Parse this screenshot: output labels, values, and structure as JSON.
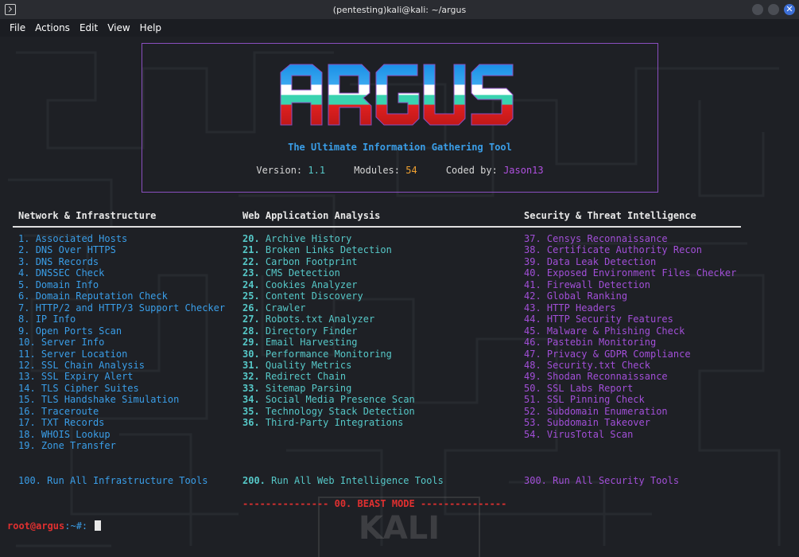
{
  "window": {
    "title": "(pentesting)kali@kali: ~/argus"
  },
  "menu": [
    "File",
    "Actions",
    "Edit",
    "View",
    "Help"
  ],
  "banner": {
    "logo_text": "ARGUS",
    "tagline": "The Ultimate Information Gathering Tool",
    "version_label": "Version: ",
    "version": "1.1",
    "modules_label": "Modules: ",
    "modules": "54",
    "coded_label": "Coded by: ",
    "author": "Jason13"
  },
  "watermark": "KALI",
  "columns": [
    {
      "header": "Network & Infrastructure",
      "items": [
        {
          "n": "1.",
          "t": "Associated Hosts"
        },
        {
          "n": "2.",
          "t": "DNS Over HTTPS"
        },
        {
          "n": "3.",
          "t": "DNS Records"
        },
        {
          "n": "4.",
          "t": "DNSSEC Check"
        },
        {
          "n": "5.",
          "t": "Domain Info"
        },
        {
          "n": "6.",
          "t": "Domain Reputation Check"
        },
        {
          "n": "7.",
          "t": "HTTP/2 and HTTP/3 Support Checker"
        },
        {
          "n": "8.",
          "t": "IP Info"
        },
        {
          "n": "9.",
          "t": "Open Ports Scan"
        },
        {
          "n": "10.",
          "t": "Server Info"
        },
        {
          "n": "11.",
          "t": "Server Location"
        },
        {
          "n": "12.",
          "t": "SSL Chain Analysis"
        },
        {
          "n": "13.",
          "t": "SSL Expiry Alert"
        },
        {
          "n": "14.",
          "t": "TLS Cipher Suites"
        },
        {
          "n": "15.",
          "t": "TLS Handshake Simulation"
        },
        {
          "n": "16.",
          "t": "Traceroute"
        },
        {
          "n": "17.",
          "t": "TXT Records"
        },
        {
          "n": "18.",
          "t": "WHOIS Lookup"
        },
        {
          "n": "19.",
          "t": "Zone Transfer"
        }
      ],
      "run_all_number": "100.",
      "run_all": "Run All Infrastructure Tools"
    },
    {
      "header": "Web Application Analysis",
      "items": [
        {
          "n": "20.",
          "t": "Archive History"
        },
        {
          "n": "21.",
          "t": "Broken Links Detection"
        },
        {
          "n": "22.",
          "t": "Carbon Footprint"
        },
        {
          "n": "23.",
          "t": "CMS Detection"
        },
        {
          "n": "24.",
          "t": "Cookies Analyzer"
        },
        {
          "n": "25.",
          "t": "Content Discovery"
        },
        {
          "n": "26.",
          "t": "Crawler"
        },
        {
          "n": "27.",
          "t": "Robots.txt Analyzer"
        },
        {
          "n": "28.",
          "t": "Directory Finder"
        },
        {
          "n": "29.",
          "t": "Email Harvesting"
        },
        {
          "n": "30.",
          "t": "Performance Monitoring"
        },
        {
          "n": "31.",
          "t": "Quality Metrics"
        },
        {
          "n": "32.",
          "t": "Redirect Chain"
        },
        {
          "n": "33.",
          "t": "Sitemap Parsing"
        },
        {
          "n": "34.",
          "t": "Social Media Presence Scan"
        },
        {
          "n": "35.",
          "t": "Technology Stack Detection"
        },
        {
          "n": "36.",
          "t": "Third-Party Integrations"
        }
      ],
      "run_all_number": "200.",
      "run_all": "Run All Web Intelligence Tools"
    },
    {
      "header": "Security & Threat Intelligence",
      "items": [
        {
          "n": "37.",
          "t": "Censys Reconnaissance"
        },
        {
          "n": "38.",
          "t": "Certificate Authority Recon"
        },
        {
          "n": "39.",
          "t": "Data Leak Detection"
        },
        {
          "n": "40.",
          "t": "Exposed Environment Files Checker"
        },
        {
          "n": "41.",
          "t": "Firewall Detection"
        },
        {
          "n": "42.",
          "t": "Global Ranking"
        },
        {
          "n": "43.",
          "t": "HTTP Headers"
        },
        {
          "n": "44.",
          "t": "HTTP Security Features"
        },
        {
          "n": "45.",
          "t": "Malware & Phishing Check"
        },
        {
          "n": "46.",
          "t": "Pastebin Monitoring"
        },
        {
          "n": "47.",
          "t": "Privacy & GDPR Compliance"
        },
        {
          "n": "48.",
          "t": "Security.txt Check"
        },
        {
          "n": "49.",
          "t": "Shodan Reconnaissance"
        },
        {
          "n": "50.",
          "t": "SSL Labs Report"
        },
        {
          "n": "51.",
          "t": "SSL Pinning Check"
        },
        {
          "n": "52.",
          "t": "Subdomain Enumeration"
        },
        {
          "n": "53.",
          "t": "Subdomain Takeover"
        },
        {
          "n": "54.",
          "t": "VirusTotal Scan"
        }
      ],
      "run_all_number": "300.",
      "run_all": "Run All Security Tools"
    }
  ],
  "beast_mode": "--------------- 00. BEAST MODE ---------------",
  "prompt": {
    "user_host": "root@argus",
    "path_symbol": ":~#:"
  },
  "colors": {
    "blue": "#3a9ee8",
    "cyan": "#56c8c8",
    "purple": "#a24fd8",
    "red": "#e03030",
    "orange": "#f0a030",
    "border": "#8a4fc0"
  },
  "icons": {
    "terminal": "terminal-icon",
    "minimize": "minimize-icon",
    "maximize": "maximize-icon",
    "close": "close-icon"
  }
}
